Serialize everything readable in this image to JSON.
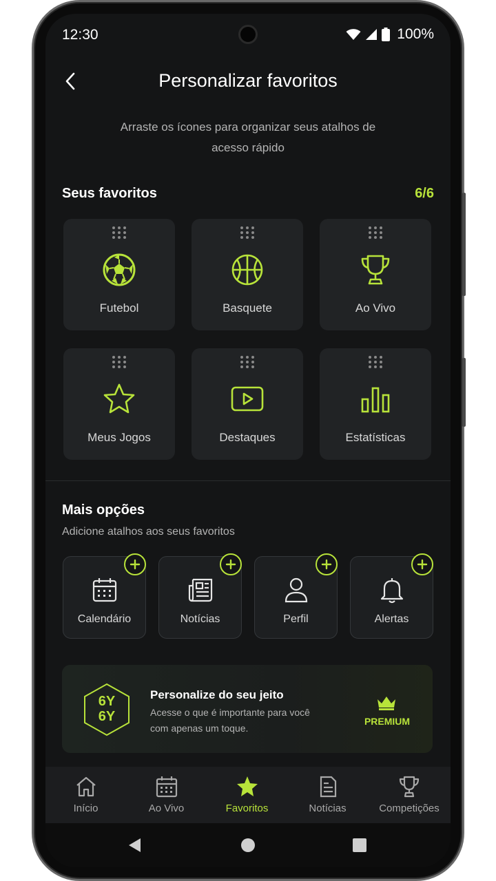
{
  "status": {
    "time": "12:30",
    "battery": "100%"
  },
  "header": {
    "title": "Personalizar favoritos",
    "subtitle": "Arraste os ícones para organizar seus atalhos de acesso rápido"
  },
  "favorites": {
    "title": "Seus favoritos",
    "count": "6/6",
    "items": [
      {
        "label": "Futebol",
        "icon": "soccer-ball-icon"
      },
      {
        "label": "Basquete",
        "icon": "basketball-icon"
      },
      {
        "label": "Ao Vivo",
        "icon": "trophy-icon"
      },
      {
        "label": "Meus Jogos",
        "icon": "star-icon"
      },
      {
        "label": "Destaques",
        "icon": "play-icon"
      },
      {
        "label": "Estatísticas",
        "icon": "bar-chart-icon"
      }
    ]
  },
  "more": {
    "title": "Mais opções",
    "subtitle": "Adicione atalhos aos seus favoritos",
    "items": [
      {
        "label": "Calendário",
        "icon": "calendar-icon"
      },
      {
        "label": "Notícias",
        "icon": "newspaper-icon"
      },
      {
        "label": "Perfil",
        "icon": "user-icon"
      },
      {
        "label": "Alertas",
        "icon": "bell-icon"
      }
    ]
  },
  "promo": {
    "logo_line1": "6Y",
    "logo_line2": "6Y",
    "title": "Personalize do seu jeito",
    "description": "Acesse o que é importante para você com apenas um toque.",
    "badge": "PREMIUM"
  },
  "nav": {
    "items": [
      {
        "label": "Início",
        "icon": "home-icon",
        "active": false
      },
      {
        "label": "Ao Vivo",
        "icon": "calendar-icon",
        "active": false
      },
      {
        "label": "Favoritos",
        "icon": "star-icon",
        "active": true
      },
      {
        "label": "Notícias",
        "icon": "document-icon",
        "active": false
      },
      {
        "label": "Competições",
        "icon": "trophy-icon",
        "active": false
      }
    ]
  },
  "colors": {
    "accent": "#b8e33a",
    "background": "#141516",
    "tile": "#212325"
  }
}
